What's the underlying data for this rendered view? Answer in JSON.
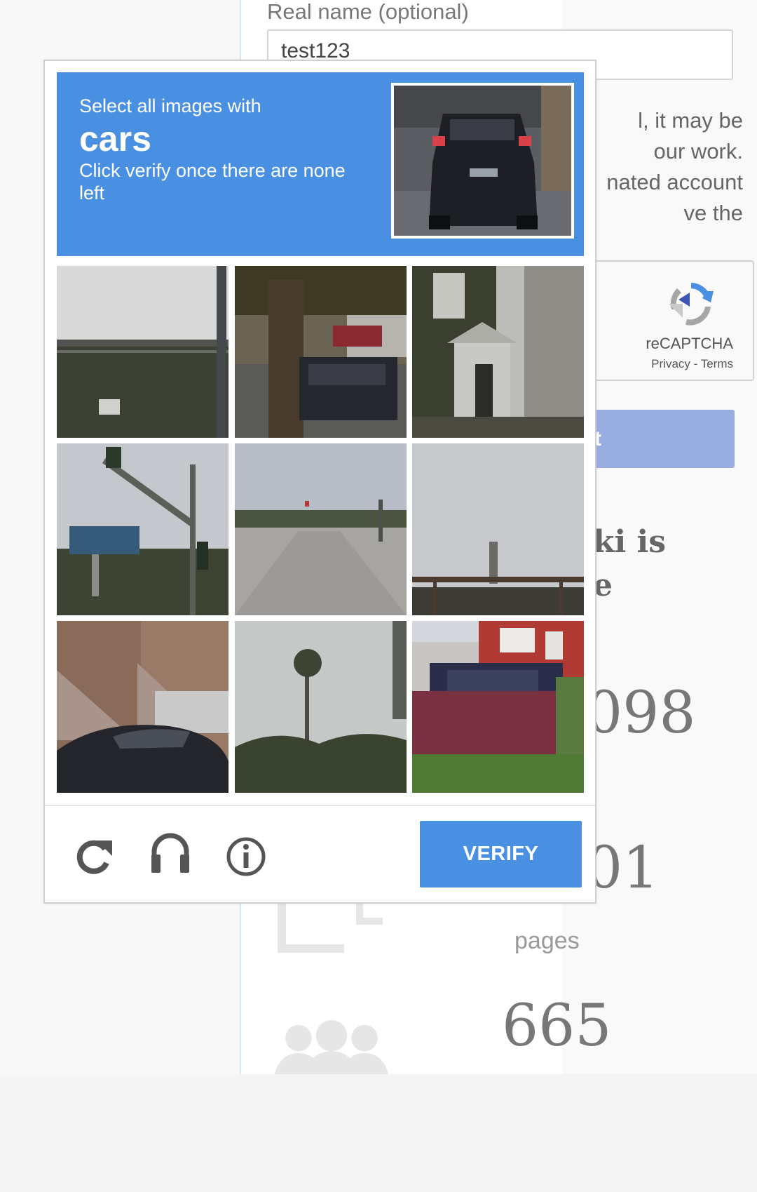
{
  "background_page": {
    "real_name_label": "Real name (optional)",
    "real_name_value": "test123",
    "notice_text": "l, it may be\nour work.\nnated account\nve the",
    "submit_label": "t",
    "wiki_heading_line1": "ki is",
    "wiki_heading_line2": "e",
    "stats": [
      {
        "value": "098"
      },
      {
        "value": "01",
        "label": "pages"
      },
      {
        "value": "665"
      }
    ],
    "colors": {
      "submit": "#98aee3",
      "divider": "#d6e7f6"
    }
  },
  "recaptcha_badge": {
    "title": "reCAPTCHA",
    "privacy": "Privacy",
    "separator": " - ",
    "terms": "Terms",
    "icon": "recaptcha-logo-icon"
  },
  "captcha": {
    "instruction": "Select all images with",
    "target": "cars",
    "subtext": "Click verify once there are none left",
    "verify_label": "VERIFY",
    "header_color": "#4a90e2",
    "tiles": [
      {
        "icon": "fence-overpass-image"
      },
      {
        "icon": "tree-with-van-image"
      },
      {
        "icon": "house-image"
      },
      {
        "icon": "traffic-light-billboard-image"
      },
      {
        "icon": "empty-road-image"
      },
      {
        "icon": "sky-with-tower-image"
      },
      {
        "icon": "brownstone-with-car-image"
      },
      {
        "icon": "palm-tree-image"
      },
      {
        "icon": "suv-in-driveway-image"
      }
    ],
    "footer_icons": [
      "reload-icon",
      "headphones-icon",
      "info-icon"
    ]
  }
}
